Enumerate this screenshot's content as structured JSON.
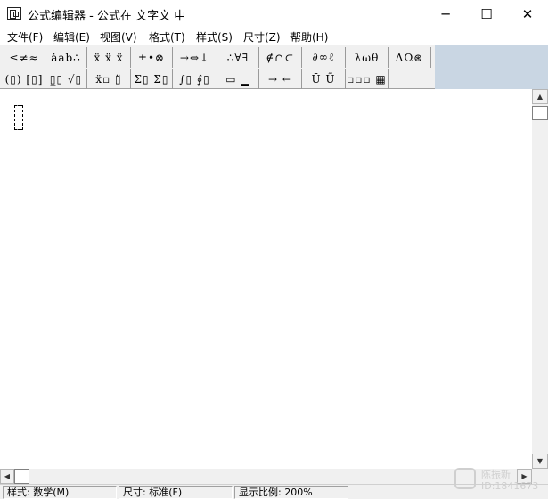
{
  "window": {
    "title": "公式编辑器 - 公式在 文字文 中",
    "minimize_glyph": "─",
    "maximize_glyph": "☐",
    "close_glyph": "✕"
  },
  "menu": [
    "文件(F)",
    "编辑(E)",
    "视图(V)",
    "格式(T)",
    "样式(S)",
    "尺寸(Z)",
    "帮助(H)"
  ],
  "toolbar": {
    "row1": [
      "≤≠≈",
      "ȧab∴",
      "ẍ ẍ ẍ",
      "±•⊗",
      "→⇔↓",
      "∴∀∃",
      "∉∩⊂",
      "∂∞ℓ",
      "λωθ",
      "ΛΩ⊛"
    ],
    "row2": [
      "(▯) [▯]",
      "▯̲▯ √▯",
      "ẍ▫ ▯̈",
      "Σ▯ Σ▯",
      "∫▯ ∮▯",
      "▭ ▁",
      "→ ←",
      "Ū Ũ",
      "▫▫▫ ▦"
    ]
  },
  "status": {
    "style": "样式: 数学(M)",
    "size": "尺寸: 标准(F)",
    "zoom": "显示比例: 200%"
  },
  "watermark": {
    "name": "陈振新",
    "id": "ID:1841673"
  },
  "scrollbar": {
    "up_glyph": "▲",
    "down_glyph": "▼",
    "left_glyph": "◀",
    "right_glyph": "▶"
  }
}
